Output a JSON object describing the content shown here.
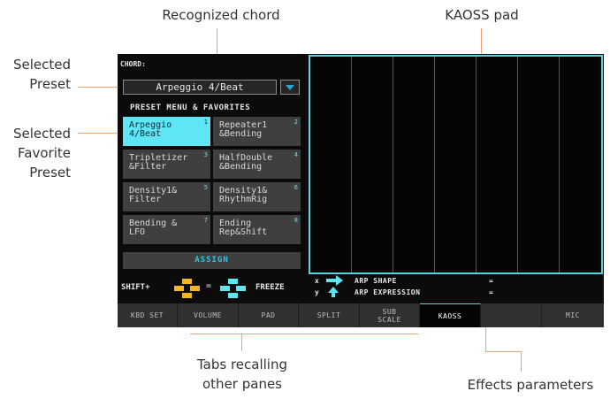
{
  "callouts": {
    "recognized_chord": "Recognized chord",
    "kaoss_pad": "KAOSS pad",
    "selected_preset": [
      "Selected",
      "Preset"
    ],
    "selected_favorite_preset": [
      "Selected",
      "Favorite",
      "Preset"
    ],
    "tabs_recalling": [
      "Tabs recalling",
      "other panes"
    ],
    "effects_parameters": "Effects parameters"
  },
  "screen": {
    "chord_label": "CHORD:",
    "preset_selected": "Arpeggio 4/Beat",
    "menu_title": "PRESET MENU & FAVORITES",
    "favorites": [
      {
        "num": "1",
        "line1": "Arpeggio",
        "line2": "4/Beat",
        "selected": true
      },
      {
        "num": "2",
        "line1": "Repeater1",
        "line2": "&Bending"
      },
      {
        "num": "3",
        "line1": "Tripletizer",
        "line2": "&Filter"
      },
      {
        "num": "4",
        "line1": "HalfDouble",
        "line2": "&Bending"
      },
      {
        "num": "5",
        "line1": "Density1&",
        "line2": "Filter"
      },
      {
        "num": "6",
        "line1": "Density1&",
        "line2": "RhythmRig"
      },
      {
        "num": "7",
        "line1": "Bending &",
        "line2": "LFO"
      },
      {
        "num": "8",
        "line1": "Ending",
        "line2": "Rep&Shift"
      }
    ],
    "assign": "ASSIGN",
    "shift_label": "SHIFT+",
    "eq1": "=",
    "eq2": "=",
    "freeze_label": "FREEZE",
    "params": [
      {
        "axis": "x",
        "name": "ARP SHAPE",
        "value": "="
      },
      {
        "axis": "y",
        "name": "ARP EXPRESSION",
        "value": "="
      }
    ],
    "tabs": [
      {
        "label": "KBD SET"
      },
      {
        "label": "VOLUME"
      },
      {
        "label": "PAD"
      },
      {
        "label": "SPLIT"
      },
      {
        "label": "SUB",
        "label2": "SCALE"
      },
      {
        "label": "KAOSS",
        "active": true
      },
      {
        "label": ""
      },
      {
        "label": "MIC"
      }
    ]
  },
  "colors": {
    "accent": "#5fe6f5",
    "arrow_yellow": "#f2b722",
    "callout_line": "#e8a27a"
  }
}
